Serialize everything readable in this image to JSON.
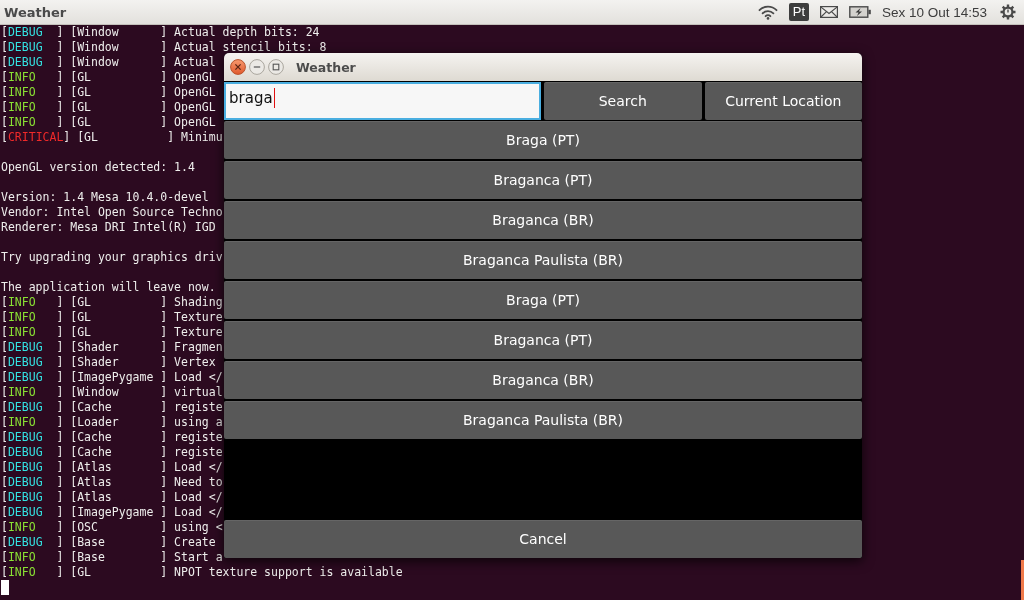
{
  "top_bar": {
    "app_title": "Weather",
    "keyboard_layout": "Pt",
    "clock": "Sex 10 Out 14:53"
  },
  "terminal": {
    "paragraphs": [
      {
        "lines": [
          {
            "kind": "log",
            "open": "[",
            "level": "DEBUG",
            "color": "#34e2e2",
            "rest": "  ] [Window      ] Actual depth bits: 24"
          },
          {
            "kind": "log",
            "open": "[",
            "level": "DEBUG",
            "color": "#34e2e2",
            "rest": "  ] [Window      ] Actual stencil bits: 8"
          },
          {
            "kind": "log",
            "open": "[",
            "level": "DEBUG",
            "color": "#34e2e2",
            "rest": "  ] [Window      ] Actual"
          },
          {
            "kind": "log",
            "open": "[",
            "level": "INFO",
            "color": "#8ae234",
            "rest": "   ] [GL          ] OpenGL"
          },
          {
            "kind": "log",
            "open": "[",
            "level": "INFO",
            "color": "#8ae234",
            "rest": "   ] [GL          ] OpenGL"
          },
          {
            "kind": "log",
            "open": "[",
            "level": "INFO",
            "color": "#8ae234",
            "rest": "   ] [GL          ] OpenGL"
          },
          {
            "kind": "log",
            "open": "[",
            "level": "INFO",
            "color": "#8ae234",
            "rest": "   ] [GL          ] OpenGL"
          },
          {
            "kind": "log",
            "open": "[",
            "level": "CRITICAL",
            "color": "#ef2929",
            "rest": "] [GL          ] Minimu"
          }
        ]
      },
      {
        "lines": [
          {
            "kind": "text",
            "text": "OpenGL version detected: 1.4"
          }
        ]
      },
      {
        "lines": [
          {
            "kind": "text",
            "text": "Version: 1.4 Mesa 10.4.0-devel"
          },
          {
            "kind": "text",
            "text": "Vendor: Intel Open Source Techno"
          },
          {
            "kind": "text",
            "text": "Renderer: Mesa DRI Intel(R) IGD"
          }
        ]
      },
      {
        "lines": [
          {
            "kind": "text",
            "text": "Try upgrading your graphics driv"
          }
        ]
      },
      {
        "lines": [
          {
            "kind": "text",
            "text": "The application will leave now."
          },
          {
            "kind": "log",
            "open": "[",
            "level": "INFO",
            "color": "#8ae234",
            "rest": "   ] [GL          ] Shading"
          },
          {
            "kind": "log",
            "open": "[",
            "level": "INFO",
            "color": "#8ae234",
            "rest": "   ] [GL          ] Texture"
          },
          {
            "kind": "log",
            "open": "[",
            "level": "INFO",
            "color": "#8ae234",
            "rest": "   ] [GL          ] Texture"
          },
          {
            "kind": "log",
            "open": "[",
            "level": "DEBUG",
            "color": "#34e2e2",
            "rest": "  ] [Shader      ] Fragmen"
          },
          {
            "kind": "log",
            "open": "[",
            "level": "DEBUG",
            "color": "#34e2e2",
            "rest": "  ] [Shader      ] Vertex"
          },
          {
            "kind": "log",
            "open": "[",
            "level": "DEBUG",
            "color": "#34e2e2",
            "rest": "  ] [ImagePygame ] Load </"
          },
          {
            "kind": "log",
            "open": "[",
            "level": "INFO",
            "color": "#8ae234",
            "rest": "   ] [Window      ] virtual"
          },
          {
            "kind": "log",
            "open": "[",
            "level": "DEBUG",
            "color": "#34e2e2",
            "rest": "  ] [Cache       ] registe"
          },
          {
            "kind": "log",
            "open": "[",
            "level": "INFO",
            "color": "#8ae234",
            "rest": "   ] [Loader      ] using a"
          },
          {
            "kind": "log",
            "open": "[",
            "level": "DEBUG",
            "color": "#34e2e2",
            "rest": "  ] [Cache       ] registe"
          },
          {
            "kind": "log",
            "open": "[",
            "level": "DEBUG",
            "color": "#34e2e2",
            "rest": "  ] [Cache       ] registe"
          },
          {
            "kind": "log",
            "open": "[",
            "level": "DEBUG",
            "color": "#34e2e2",
            "rest": "  ] [Atlas       ] Load </"
          },
          {
            "kind": "log",
            "open": "[",
            "level": "DEBUG",
            "color": "#34e2e2",
            "rest": "  ] [Atlas       ] Need to"
          },
          {
            "kind": "log",
            "open": "[",
            "level": "DEBUG",
            "color": "#34e2e2",
            "rest": "  ] [Atlas       ] Load </"
          },
          {
            "kind": "log",
            "open": "[",
            "level": "DEBUG",
            "color": "#34e2e2",
            "rest": "  ] [ImagePygame ] Load </"
          },
          {
            "kind": "log",
            "open": "[",
            "level": "INFO",
            "color": "#8ae234",
            "rest": "   ] [OSC         ] using <"
          },
          {
            "kind": "log",
            "open": "[",
            "level": "DEBUG",
            "color": "#34e2e2",
            "rest": "  ] [Base        ] Create"
          },
          {
            "kind": "log",
            "open": "[",
            "level": "INFO",
            "color": "#8ae234",
            "rest": "   ] [Base        ] Start a"
          },
          {
            "kind": "log",
            "open": "[",
            "level": "INFO",
            "color": "#8ae234",
            "rest": "   ] [GL          ] NPOT texture support is available"
          }
        ]
      }
    ]
  },
  "dialog": {
    "title": "Weather",
    "search": {
      "value": "braga",
      "focused": true
    },
    "actions": [
      {
        "label": "Search"
      },
      {
        "label": "Current Location"
      }
    ],
    "results": [
      {
        "label": "Braga (PT)"
      },
      {
        "label": "Braganca (PT)"
      },
      {
        "label": "Braganca (BR)"
      },
      {
        "label": "Braganca Paulista (BR)"
      },
      {
        "label": "Braga (PT)"
      },
      {
        "label": "Braganca (PT)"
      },
      {
        "label": "Braganca (BR)"
      },
      {
        "label": "Braganca Paulista (BR)"
      }
    ],
    "cancel": {
      "label": "Cancel"
    }
  }
}
